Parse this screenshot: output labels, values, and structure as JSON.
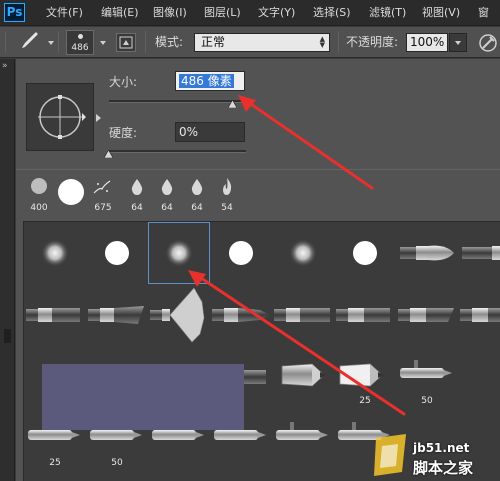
{
  "app": {
    "logo": "Ps"
  },
  "menu": [
    "文件(F)",
    "编辑(E)",
    "图像(I)",
    "图层(L)",
    "文字(Y)",
    "选择(S)",
    "滤镜(T)",
    "视图(V)",
    "窗"
  ],
  "options_bar": {
    "brush_size": "486",
    "mode_label": "模式:",
    "mode_value": "正常",
    "opacity_label": "不透明度:",
    "opacity_value": "100%"
  },
  "brush_panel": {
    "size_label": "大小:",
    "size_value": "486 像素",
    "hardness_label": "硬度:",
    "hardness_value": "0%",
    "recent_brushes": [
      {
        "size": "400",
        "type": "soft-round"
      },
      {
        "size": "",
        "type": "hard-round-large"
      },
      {
        "size": "675",
        "type": "scatter"
      },
      {
        "size": "64",
        "type": "drop"
      },
      {
        "size": "64",
        "type": "drop"
      },
      {
        "size": "64",
        "type": "drop"
      },
      {
        "size": "54",
        "type": "flame"
      }
    ],
    "grid_labels": [
      "25",
      "50",
      "25",
      "50"
    ]
  },
  "watermark": {
    "line1": "jb51.net",
    "line2": "脚本之家"
  },
  "colors": {
    "accent_arrow": "#e8302c",
    "selection_blue": "#3478d8",
    "ps_blue": "#31a8ff"
  }
}
